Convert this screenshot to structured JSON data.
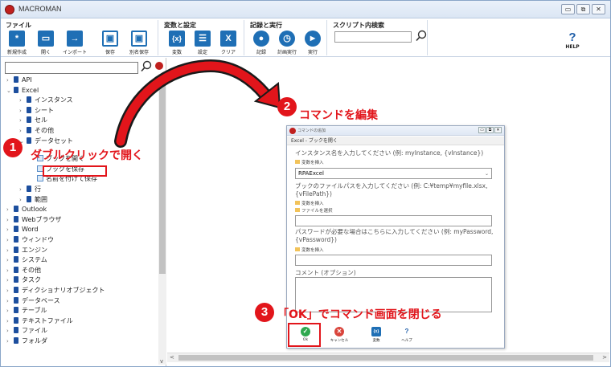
{
  "app": {
    "title": "MACROMAN"
  },
  "window_buttons": [
    "▭",
    "⧉",
    "✕"
  ],
  "ribbon": {
    "groups": [
      {
        "label": "ファイル",
        "buttons": [
          {
            "label": "新規作成",
            "icon": "asterisk-icon",
            "glyph": "*"
          },
          {
            "label": "開く",
            "icon": "folder-icon",
            "glyph": "▭"
          },
          {
            "label": "インポート",
            "icon": "import-icon",
            "glyph": "→"
          },
          {
            "label": "保存",
            "icon": "save-icon",
            "glyph": "▣"
          },
          {
            "label": "別名保存",
            "icon": "save-as-icon",
            "glyph": "▣"
          }
        ]
      },
      {
        "label": "変数と設定",
        "buttons": [
          {
            "label": "変数",
            "icon": "variable-icon",
            "glyph": "{x}"
          },
          {
            "label": "設定",
            "icon": "settings-icon",
            "glyph": "☰"
          },
          {
            "label": "クリア",
            "icon": "clear-icon",
            "glyph": "X"
          }
        ]
      },
      {
        "label": "記録と実行",
        "buttons": [
          {
            "label": "記録",
            "icon": "record-icon",
            "glyph": "●"
          },
          {
            "label": "計画実行",
            "icon": "schedule-icon",
            "glyph": "◷"
          },
          {
            "label": "実行",
            "icon": "run-icon",
            "glyph": "▶"
          }
        ]
      },
      {
        "label": "スクリプト内検索"
      }
    ],
    "search_value": "",
    "help_label": "HELP",
    "help_glyph": "?"
  },
  "tree": {
    "search_value": "",
    "items": [
      {
        "label": "API",
        "level": 0,
        "type": "folder",
        "arrow": "›"
      },
      {
        "label": "Excel",
        "level": 0,
        "type": "folder",
        "arrow": "⌄"
      },
      {
        "label": "インスタンス",
        "level": 1,
        "type": "folder",
        "arrow": "›"
      },
      {
        "label": "シート",
        "level": 1,
        "type": "folder",
        "arrow": "›"
      },
      {
        "label": "セル",
        "level": 1,
        "type": "folder",
        "arrow": "›"
      },
      {
        "label": "その他",
        "level": 1,
        "type": "folder",
        "arrow": "›"
      },
      {
        "label": "データセット",
        "level": 1,
        "type": "folder",
        "arrow": "⌄"
      },
      {
        "label": "",
        "level": 2,
        "type": "spacer"
      },
      {
        "label": "ブックを開く",
        "level": 2,
        "type": "command"
      },
      {
        "label": "ブックを保存",
        "level": 2,
        "type": "command"
      },
      {
        "label": "名前を付けて保存",
        "level": 2,
        "type": "command"
      },
      {
        "label": "行",
        "level": 1,
        "type": "folder",
        "arrow": "›"
      },
      {
        "label": "範囲",
        "level": 1,
        "type": "folder",
        "arrow": "›"
      },
      {
        "label": "Outlook",
        "level": 0,
        "type": "folder",
        "arrow": "›"
      },
      {
        "label": "Webブラウザ",
        "level": 0,
        "type": "folder",
        "arrow": "›"
      },
      {
        "label": "Word",
        "level": 0,
        "type": "folder",
        "arrow": "›"
      },
      {
        "label": "ウィンドウ",
        "level": 0,
        "type": "folder",
        "arrow": "›"
      },
      {
        "label": "エンジン",
        "level": 0,
        "type": "folder",
        "arrow": "›"
      },
      {
        "label": "システム",
        "level": 0,
        "type": "folder",
        "arrow": "›"
      },
      {
        "label": "その他",
        "level": 0,
        "type": "folder",
        "arrow": "›"
      },
      {
        "label": "タスク",
        "level": 0,
        "type": "folder",
        "arrow": "›"
      },
      {
        "label": "ディクショナリオブジェクト",
        "level": 0,
        "type": "folder",
        "arrow": "›"
      },
      {
        "label": "データベース",
        "level": 0,
        "type": "folder",
        "arrow": "›"
      },
      {
        "label": "テーブル",
        "level": 0,
        "type": "folder",
        "arrow": "›"
      },
      {
        "label": "テキストファイル",
        "level": 0,
        "type": "folder",
        "arrow": "›"
      },
      {
        "label": "ファイル",
        "level": 0,
        "type": "folder",
        "arrow": "›"
      },
      {
        "label": "フォルダ",
        "level": 0,
        "type": "folder",
        "arrow": "›"
      }
    ]
  },
  "dialog": {
    "title": "コマンドの追加",
    "subtitle": "Excel - ブックを開く",
    "instance_prompt": "インスタンス名を入力してください (例: myInstance, {vInstance})",
    "insert_variable": "変数を挿入",
    "instance_value": "RPAExcel",
    "path_prompt": "ブックのファイルパスを入力してください (例: C:¥temp¥myfile.xlsx, {vFilePath})",
    "select_file": "ファイルを選択",
    "path_value": "",
    "password_prompt": "パスワードが必要な場合はこちらに入力してください (例: myPassword, {vPassword})",
    "password_value": "",
    "comment_label": "コメント (オプション)",
    "comment_value": "",
    "buttons": {
      "ok": "Ok",
      "cancel": "キャンセル",
      "variable": "変数",
      "help": "ヘルプ"
    }
  },
  "annotations": {
    "step1_number": "1",
    "step1_text": "ダブルクリックで開く",
    "step2_number": "2",
    "step2_text": "コマンドを編集",
    "step3_number": "3",
    "step3_text": "「OK」でコマンド画面を閉じる"
  },
  "colors": {
    "accent": "#1f6fb5",
    "annotation_red": "#e2151b",
    "ok_green": "#2fa84f",
    "cancel_red": "#d9453c"
  }
}
